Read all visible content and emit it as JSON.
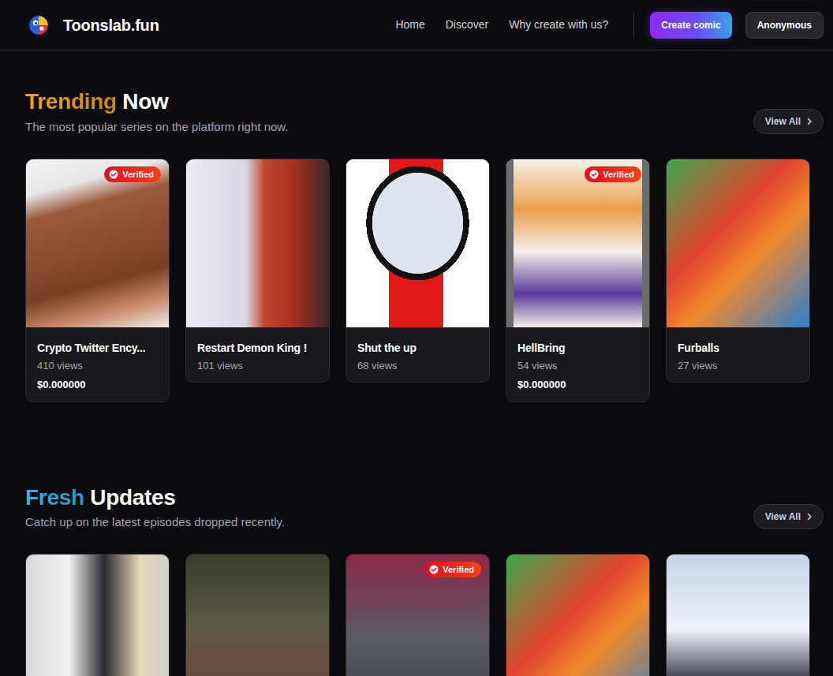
{
  "brand": {
    "name": "Toonslab.fun"
  },
  "nav": {
    "links": [
      {
        "label": "Home"
      },
      {
        "label": "Discover"
      },
      {
        "label": "Why create with us?"
      }
    ],
    "create_button": "Create comic",
    "user_button": "Anonymous"
  },
  "sections": [
    {
      "title_accent": "Trending",
      "title_rest": "Now",
      "color": "#f7a21b",
      "subtitle": "The most popular series on the platform right now.",
      "view_all": "View All",
      "cards": [
        {
          "title": "Crypto Twitter Ency...",
          "views": "410 views",
          "price": "$0.000000",
          "verified": true
        },
        {
          "title": "Restart Demon King !",
          "views": "101 views",
          "verified": false
        },
        {
          "title": "Shut the up",
          "views": "68 views",
          "verified": false
        },
        {
          "title": "HellBring",
          "views": "54 views",
          "price": "$0.000000",
          "verified": true
        },
        {
          "title": "Furballs",
          "views": "27 views",
          "verified": false
        }
      ]
    },
    {
      "title_accent": "Fresh",
      "title_rest": "Updates",
      "color": "#2cb8f0",
      "subtitle": "Catch up on the latest episodes dropped recently.",
      "view_all": "View All",
      "cards": [
        {
          "verified": false
        },
        {
          "verified": false
        },
        {
          "verified": true
        },
        {
          "verified": false
        },
        {
          "verified": false
        }
      ]
    }
  ]
}
